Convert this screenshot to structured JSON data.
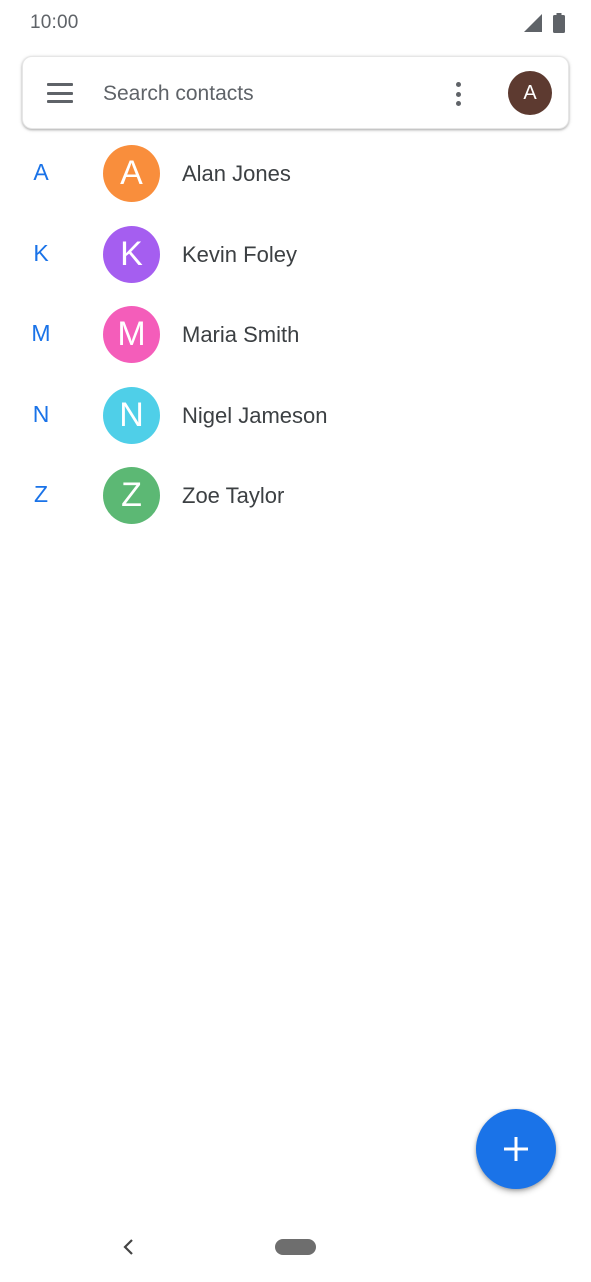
{
  "status_bar": {
    "time": "10:00",
    "icons": [
      "cell-signal-icon",
      "battery-icon"
    ]
  },
  "search": {
    "placeholder": "Search contacts",
    "account_initial": "A",
    "account_color": "#5d3a30",
    "icons": [
      "menu-icon",
      "more-vert-icon"
    ]
  },
  "contacts": [
    {
      "section": "A",
      "initial": "A",
      "name": "Alan Jones",
      "color": "#f98e3c"
    },
    {
      "section": "K",
      "initial": "K",
      "name": "Kevin Foley",
      "color": "#a55ef0"
    },
    {
      "section": "M",
      "initial": "M",
      "name": "Maria Smith",
      "color": "#f45dba"
    },
    {
      "section": "N",
      "initial": "N",
      "name": "Nigel Jameson",
      "color": "#4fcfe8"
    },
    {
      "section": "Z",
      "initial": "Z",
      "name": "Zoe Taylor",
      "color": "#5cb874"
    }
  ],
  "fab": {
    "icon": "add-icon",
    "color": "#1a73e8"
  },
  "nav": {
    "icons": [
      "back-icon",
      "home-pill-icon"
    ]
  },
  "colors": {
    "accent": "#1a73e8",
    "text_primary": "#3c4043",
    "text_secondary": "#5f6368"
  }
}
